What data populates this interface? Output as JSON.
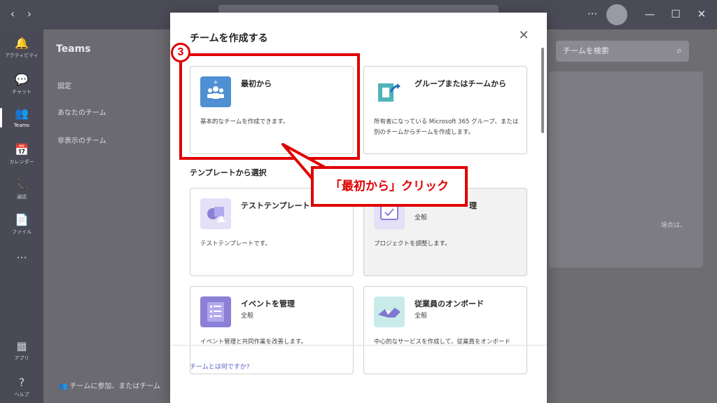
{
  "titlebar": {
    "back": "‹",
    "forward": "›",
    "more": "···",
    "minimize": "—",
    "maximize": "☐",
    "close": "✕"
  },
  "rail": {
    "items": [
      {
        "label": "アクティビティ",
        "icon": "🔔"
      },
      {
        "label": "チャット",
        "icon": "💬"
      },
      {
        "label": "Teams",
        "icon": "👥"
      },
      {
        "label": "カレンダー",
        "icon": "📅"
      },
      {
        "label": "通話",
        "icon": "📞"
      },
      {
        "label": "ファイル",
        "icon": "📄"
      },
      {
        "label": "",
        "icon": "···"
      },
      {
        "label": "アプリ",
        "icon": "▦"
      },
      {
        "label": "ヘルプ",
        "icon": "?"
      }
    ]
  },
  "leftpanel": {
    "title": "Teams",
    "items": [
      "固定",
      "あなたのチーム",
      "非表示のチーム"
    ],
    "join": "チームに参加、またはチーム"
  },
  "main": {
    "search_placeholder": "チームを検索",
    "side_text": "場合は。"
  },
  "dialog": {
    "title": "チームを作成する",
    "close": "✕",
    "section_label": "テンプレートから選択",
    "footer_link": "チームとは何ですか?",
    "cards": [
      {
        "title": "最初から",
        "subtitle": "",
        "description": "基本的なチームを作成できます。",
        "icon": "people-plus-icon",
        "color": "#4f8fd3"
      },
      {
        "title": "グループまたはチームから",
        "subtitle": "",
        "description": "所有者になっている Microsoft 365 グループ、または別のチームからチームを作成します。",
        "icon": "group-arrow-icon",
        "color": "#4fb3b8"
      },
      {
        "title": "テストテンプレート",
        "subtitle": "",
        "description": "テストテンプレートです。",
        "icon": "shapes-icon",
        "color": "#8b7fd6"
      },
      {
        "title": "理",
        "subtitle": "全般",
        "description": "プロジェクトを調整します。",
        "icon": "checkbox-icon",
        "color": "#8b7fd6"
      },
      {
        "title": "イベントを管理",
        "subtitle": "全般",
        "description": "イベント管理と共同作業を改善します。",
        "icon": "checklist-icon",
        "color": "#8b7fd6"
      },
      {
        "title": "従業員のオンボード",
        "subtitle": "全般",
        "description": "中心的なサービスを作成して、従業員をオンボード",
        "icon": "handshake-icon",
        "color": "#5cbfb8"
      }
    ]
  },
  "annotation": {
    "step": "3",
    "callout": "「最初から」クリック",
    "color": "#e00000"
  }
}
